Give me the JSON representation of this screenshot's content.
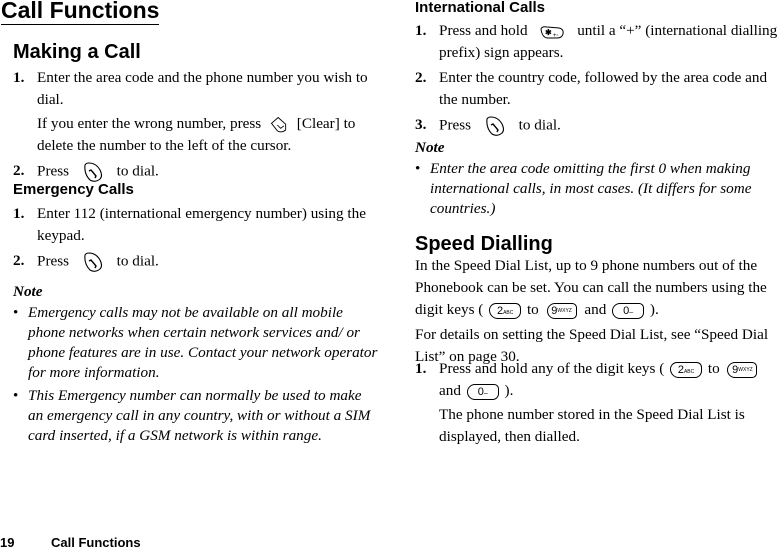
{
  "page_title": "Call Functions",
  "making_call": {
    "heading": "Making a Call",
    "steps": [
      {
        "num": "1.",
        "text": "Enter the area code and the phone number you wish to dial.",
        "sub_before": "If you enter the wrong number, press",
        "sub_key": "clear-key-icon",
        "sub_after": "[Clear] to delete the number to the left of the cursor."
      },
      {
        "num": "2.",
        "before": "Press",
        "key": "send-key-icon",
        "after": "to dial."
      }
    ]
  },
  "emergency": {
    "heading": "Emergency Calls",
    "steps": [
      {
        "num": "1.",
        "text": "Enter 112 (international emergency number) using the keypad."
      },
      {
        "num": "2.",
        "before": "Press",
        "key": "send-key-icon",
        "after": "to dial."
      }
    ],
    "note_title": "Note",
    "notes": [
      "Emergency calls may not be available on all mobile phone networks when certain network services and/ or phone features are in use. Contact your network operator for more information.",
      "This Emergency number can normally be used to make an emergency call in any country, with or without a SIM card inserted, if a GSM network is within range."
    ]
  },
  "international": {
    "heading": "International Calls",
    "steps": [
      {
        "num": "1.",
        "before": "Press and hold",
        "key": "star-plus-key-icon",
        "after": "until a “+” (international dialling prefix) sign appears."
      },
      {
        "num": "2.",
        "text": "Enter the country code, followed by the area code and the number."
      },
      {
        "num": "3.",
        "before": "Press",
        "key": "send-key-icon",
        "after": "to dial."
      }
    ],
    "note_title": "Note",
    "notes": [
      "Enter the area code omitting the first 0 when making international calls, in most cases. (It differs for some countries.)"
    ]
  },
  "speed_dialling": {
    "heading": "Speed Dialling",
    "intro_before": "In the Speed Dial List, up to 9 phone numbers out of the Phonebook can be set. You can call the numbers using the digit keys (",
    "intro_to": "to",
    "intro_and": "and",
    "intro_after": ").",
    "details": "For details on setting the Speed Dial List, see “Speed Dial List” on page 30.",
    "steps": [
      {
        "num": "1.",
        "before": "Press and hold any of the digit keys (",
        "to": "to",
        "and": "and",
        "after": ").",
        "sub": "The phone number stored in the Speed Dial List is displayed, then dialled."
      }
    ],
    "keys": {
      "k2": "2",
      "k2_sub": "ABC",
      "k9": "9",
      "k9_sub": "WXYZ",
      "k0": "0",
      "k0_sub": "–"
    }
  },
  "footer": {
    "page_number": "19",
    "section": "Call Functions"
  }
}
